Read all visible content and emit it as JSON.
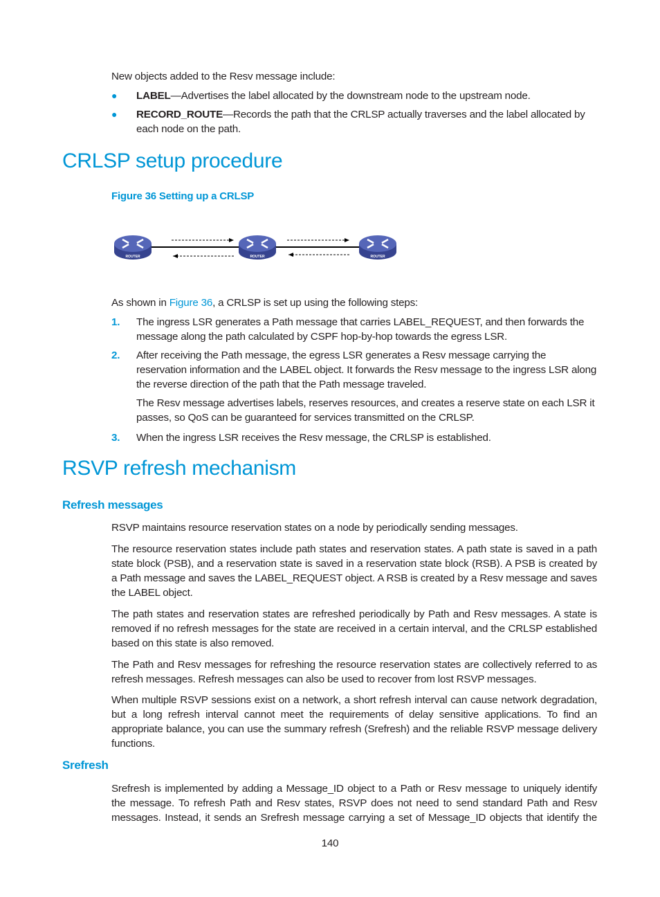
{
  "intro": {
    "lead": "New objects added to the Resv message include:",
    "bullets": [
      {
        "term": "LABEL",
        "text": "—Advertises the label allocated by the downstream node to the upstream node."
      },
      {
        "term": "RECORD_ROUTE",
        "text": "—Records the path that the CRLSP actually traverses and the label allocated by each node on the path."
      }
    ]
  },
  "crlsp": {
    "heading": "CRLSP setup procedure",
    "figure_caption": "Figure 36 Setting up a CRLSP",
    "figure": {
      "router_label": "ROUTER",
      "router_color": "#4f5fb0"
    },
    "lead_before": "As shown in ",
    "lead_link": "Figure 36",
    "lead_after": ", a CRLSP is set up using the following steps:",
    "steps": [
      {
        "num": "1.",
        "text": "The ingress LSR generates a Path message that carries LABEL_REQUEST, and then forwards the message along the path calculated by CSPF hop-by-hop towards the egress LSR."
      },
      {
        "num": "2.",
        "text": "After receiving the Path message, the egress LSR generates a Resv message carrying the reservation information and the LABEL object. It forwards the Resv message to the ingress LSR along the reverse direction of the path that the Path message traveled.",
        "extra": "The Resv message advertises labels, reserves resources, and creates a reserve state on each LSR it passes, so QoS can be guaranteed for services transmitted on the CRLSP."
      },
      {
        "num": "3.",
        "text": "When the ingress LSR receives the Resv message, the CRLSP is established."
      }
    ]
  },
  "rsvp": {
    "heading": "RSVP refresh mechanism",
    "refresh": {
      "heading": "Refresh messages",
      "paragraphs": [
        "RSVP maintains resource reservation states on a node by periodically sending messages.",
        "The resource reservation states include path states and reservation states. A path state is saved in a path state block (PSB), and a reservation state is saved in a reservation state block (RSB). A PSB is created by a Path message and saves the LABEL_REQUEST object. A RSB is created by a Resv message and saves the LABEL object.",
        "The path states and reservation states are refreshed periodically by Path and Resv messages. A state is removed if no refresh messages for the state are received in a certain interval, and the CRLSP established based on this state is also removed.",
        "The Path and Resv messages for refreshing the resource reservation states are collectively referred to as refresh messages. Refresh messages can also be used to recover from lost RSVP messages.",
        "When multiple RSVP sessions exist on a network, a short refresh interval can cause network degradation, but a long refresh interval cannot meet the requirements of delay sensitive applications. To find an appropriate balance, you can use the summary refresh (Srefresh) and the reliable RSVP message delivery functions."
      ]
    },
    "srefresh": {
      "heading": "Srefresh",
      "paragraphs": [
        "Srefresh is implemented by adding a Message_ID object to a Path or Resv message to uniquely identify the message. To refresh Path and Resv states, RSVP does not need to send standard Path and Resv messages. Instead, it sends an Srefresh message carrying a set of Message_ID objects that identify the"
      ]
    }
  },
  "footer": {
    "page_number": "140"
  }
}
